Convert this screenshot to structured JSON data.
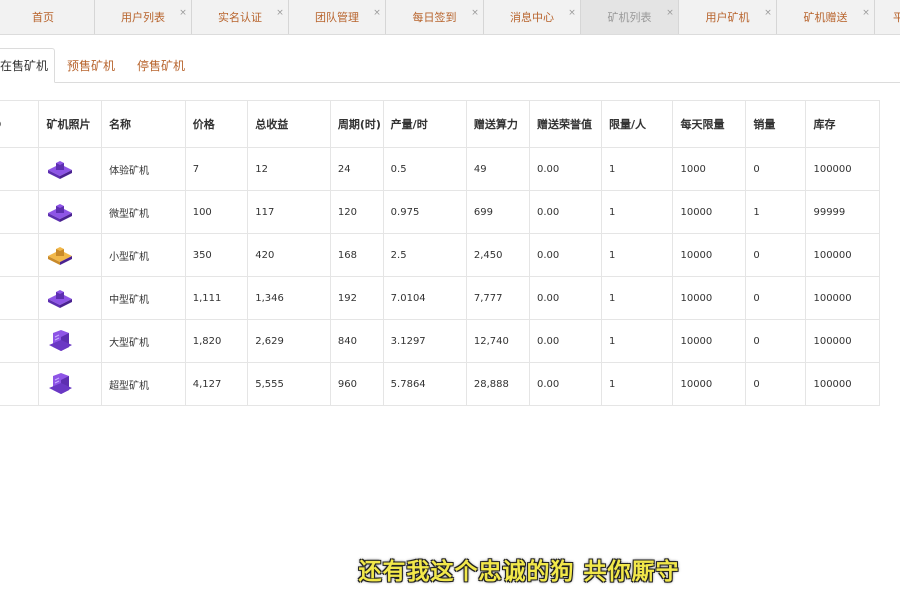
{
  "tabs": [
    {
      "label": "首页",
      "active": false,
      "closable": false
    },
    {
      "label": "用户列表",
      "active": false,
      "closable": true
    },
    {
      "label": "实名认证",
      "active": false,
      "closable": true
    },
    {
      "label": "团队管理",
      "active": false,
      "closable": true
    },
    {
      "label": "每日签到",
      "active": false,
      "closable": true
    },
    {
      "label": "消息中心",
      "active": false,
      "closable": true
    },
    {
      "label": "矿机列表",
      "active": true,
      "closable": true
    },
    {
      "label": "用户矿机",
      "active": false,
      "closable": true
    },
    {
      "label": "矿机赠送",
      "active": false,
      "closable": true
    },
    {
      "label": "平",
      "active": false,
      "closable": false
    }
  ],
  "subtabs": [
    {
      "label": "在售矿机",
      "active": true
    },
    {
      "label": "预售矿机",
      "active": false
    },
    {
      "label": "停售矿机",
      "active": false
    }
  ],
  "table": {
    "columns": [
      "ID",
      "矿机照片",
      "名称",
      "价格",
      "总收益",
      "周期(时)",
      "产量/时",
      "赠送算力",
      "赠送荣誉值",
      "限量/人",
      "每天限量",
      "销量",
      "库存"
    ],
    "rows": [
      {
        "id": "",
        "image": "miner-small-icon",
        "name": "体验矿机",
        "price": "7",
        "total": "12",
        "cycle": "24",
        "output": "0.5",
        "bonus_power": "49",
        "honor": "0.00",
        "limit_per_user": "1",
        "daily_limit": "1000",
        "sold": "0",
        "stock": "100000"
      },
      {
        "id": "",
        "image": "miner-small-icon",
        "name": "微型矿机",
        "price": "100",
        "total": "117",
        "cycle": "120",
        "output": "0.975",
        "bonus_power": "699",
        "honor": "0.00",
        "limit_per_user": "1",
        "daily_limit": "10000",
        "sold": "1",
        "stock": "99999"
      },
      {
        "id": "",
        "image": "miner-gold-icon",
        "name": "小型矿机",
        "price": "350",
        "total": "420",
        "cycle": "168",
        "output": "2.5",
        "bonus_power": "2,450",
        "honor": "0.00",
        "limit_per_user": "1",
        "daily_limit": "10000",
        "sold": "0",
        "stock": "100000"
      },
      {
        "id": "",
        "image": "miner-medium-icon",
        "name": "中型矿机",
        "price": "1,111",
        "total": "1,346",
        "cycle": "192",
        "output": "7.0104",
        "bonus_power": "7,777",
        "honor": "0.00",
        "limit_per_user": "1",
        "daily_limit": "10000",
        "sold": "0",
        "stock": "100000"
      },
      {
        "id": "",
        "image": "miner-large-icon",
        "name": "大型矿机",
        "price": "1,820",
        "total": "2,629",
        "cycle": "840",
        "output": "3.1297",
        "bonus_power": "12,740",
        "honor": "0.00",
        "limit_per_user": "1",
        "daily_limit": "10000",
        "sold": "0",
        "stock": "100000"
      },
      {
        "id": "",
        "image": "miner-super-icon",
        "name": "超型矿机",
        "price": "4,127",
        "total": "5,555",
        "cycle": "960",
        "output": "5.7864",
        "bonus_power": "28,888",
        "honor": "0.00",
        "limit_per_user": "1",
        "daily_limit": "10000",
        "sold": "0",
        "stock": "100000"
      }
    ]
  },
  "subtitle": "还有我这个忠诚的狗 共你厮守",
  "colors": {
    "tab_text": "#b8642d",
    "accent_purple": "#7a3fd1",
    "subtitle": "#f2e84a"
  }
}
